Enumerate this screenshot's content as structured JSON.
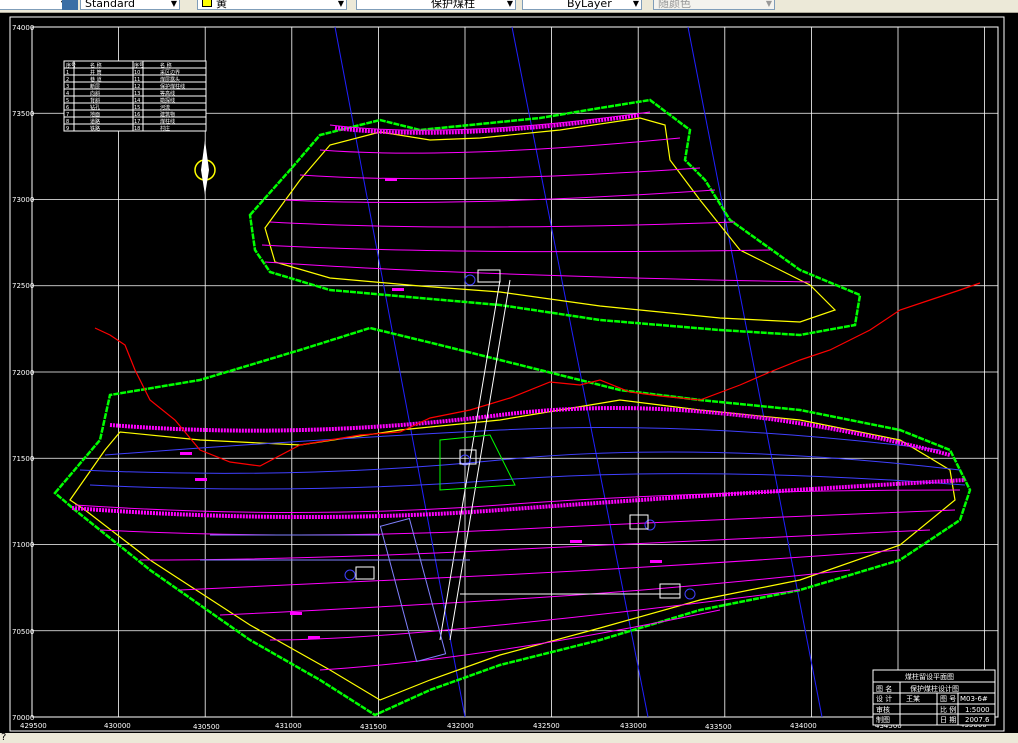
{
  "toolbar": {
    "style_combo": "Standard",
    "color_combo": "黄",
    "layer_combo": "保护煤柱",
    "linetype_combo": "ByLayer",
    "lineweight_combo": "随颜色"
  },
  "axes": {
    "y_labels": [
      "74000",
      "73500",
      "73000",
      "72500",
      "72000",
      "71500",
      "71000",
      "70500",
      "70000"
    ],
    "x_labels": [
      "429500",
      "430000",
      "430500",
      "431000",
      "431500",
      "432000",
      "432500",
      "433000",
      "433500",
      "434000",
      "434500",
      "435000"
    ]
  },
  "legend": {
    "headers": [
      "序号",
      "名 称",
      "序号",
      "名 称"
    ],
    "rows": [
      [
        "1",
        "井 筒",
        "10",
        "采区边界"
      ],
      [
        "2",
        "巷 道",
        "11",
        "煤层露头"
      ],
      [
        "3",
        "断层",
        "12",
        "保护煤柱线"
      ],
      [
        "4",
        "向斜",
        "13",
        "等高线"
      ],
      [
        "5",
        "背斜",
        "14",
        "勘探线"
      ],
      [
        "6",
        "钻孔",
        "15",
        "河流"
      ],
      [
        "7",
        "地面",
        "16",
        "建筑物"
      ],
      [
        "8",
        "道路",
        "17",
        "煤柱线"
      ],
      [
        "9",
        "铁路",
        "18",
        "村庄"
      ]
    ]
  },
  "title_block": {
    "title": "煤柱留设平面图",
    "name_label": "图 名",
    "name_value": "保护煤柱设计图",
    "designer_label": "设 计",
    "designer_value": "王某",
    "number_label": "图 号",
    "number_value": "M03-6#",
    "checker_label": "审核",
    "scale_label": "比 例",
    "scale_value": "1:5000",
    "drawer_label": "制图",
    "date_label": "日 期",
    "date_value": "2007.6"
  },
  "status": {
    "prompt": "?"
  },
  "colors": {
    "grid": "#ffffff",
    "boundary": "#00ff00",
    "pillar": "#ffff00",
    "contour": "#ff00ff",
    "river": "#ff0000",
    "exploration": "#0000ff"
  }
}
